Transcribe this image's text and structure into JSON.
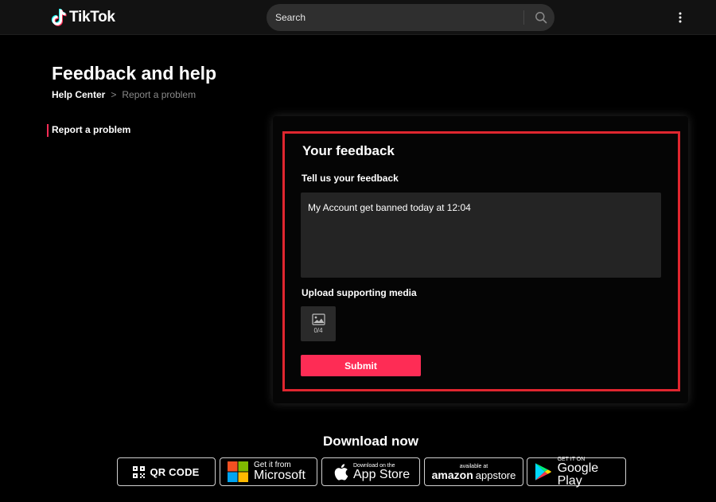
{
  "header": {
    "brand": "TikTok",
    "search_placeholder": "Search"
  },
  "page": {
    "title": "Feedback and help",
    "breadcrumb": {
      "home": "Help Center",
      "separator": ">",
      "current": "Report a problem"
    }
  },
  "sidebar": {
    "items": [
      {
        "label": "Report a problem",
        "active": true
      }
    ]
  },
  "feedback": {
    "title": "Your feedback",
    "label": "Tell us your feedback",
    "value": "My Account get banned today at 12:04",
    "upload_label": "Upload supporting media",
    "upload_count": "0/4",
    "submit_label": "Submit"
  },
  "download": {
    "title": "Download now",
    "qr_label": "QR CODE",
    "microsoft": {
      "small": "Get it from",
      "big": "Microsoft"
    },
    "appstore": {
      "small": "Download on the",
      "big": "App Store"
    },
    "amazon": {
      "small": "available at",
      "brand": "amazon",
      "store": "appstore"
    },
    "googleplay": {
      "small": "GET IT ON",
      "big": "Google Play"
    }
  },
  "colors": {
    "accent": "#fe2c55",
    "highlight_border": "#e0262f",
    "background": "#000000",
    "topbar": "#121212"
  }
}
